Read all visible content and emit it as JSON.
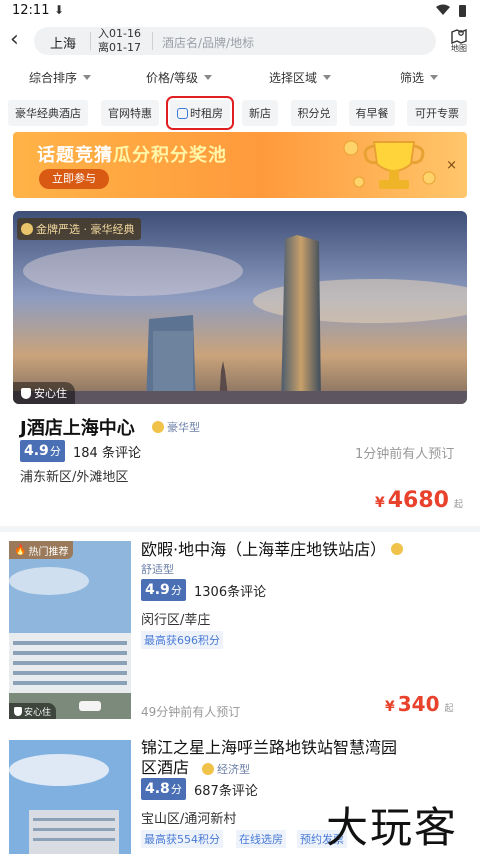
{
  "status_bar": {
    "time": "12:11",
    "download_glyph": "⬇"
  },
  "search": {
    "city": "上海",
    "checkin": "入01-16",
    "checkout": "离01-17",
    "placeholder": "酒店名/品牌/地标",
    "map_label": "地图"
  },
  "filters": [
    "综合排序",
    "价格/等级",
    "选择区域",
    "筛选"
  ],
  "chips": [
    "豪华经典酒店",
    "官网特惠",
    "时租房",
    "新店",
    "积分兑",
    "有早餐",
    "可开专票"
  ],
  "banner": {
    "title_a": "话题竞猜",
    "title_b": "瓜分积分奖池",
    "cta": "立即参与",
    "close": "×"
  },
  "hotels": [
    {
      "badge": "金牌严选 · 豪华经典",
      "safe": "安心住",
      "name": "J酒店上海中心",
      "tier": "豪华型",
      "score": "4.9",
      "score_unit": "分",
      "reviews": "184 条评论",
      "recent": "1分钟前有人预订",
      "location": "浦东新区/外滩地区",
      "currency": "¥",
      "price": "4680",
      "price_suffix": "起"
    },
    {
      "badge": "热门推荐",
      "safe": "安心住",
      "name": "欧暇·地中海（上海莘庄地铁站店）",
      "tier": "舒适型",
      "score": "4.9",
      "score_unit": "分",
      "reviews": "1306条评论",
      "location": "闵行区/莘庄",
      "points": "最高获696积分",
      "recent": "49分钟前有人预订",
      "currency": "¥",
      "price": "340",
      "price_suffix": "起"
    },
    {
      "name_line1": "锦江之星上海呼兰路地铁站智慧湾园",
      "name_line2": "区酒店",
      "tier": "经济型",
      "score": "4.8",
      "score_unit": "分",
      "reviews": "687条评论",
      "location": "宝山区/通河新村",
      "points": "最高获554积分",
      "tag1": "在线选房",
      "tag2": "预约发票"
    }
  ],
  "watermark": "大玩客",
  "colors": {
    "accent_red": "#e8412c",
    "score_blue": "#4a6fb5",
    "highlight_box": "#e02020"
  }
}
